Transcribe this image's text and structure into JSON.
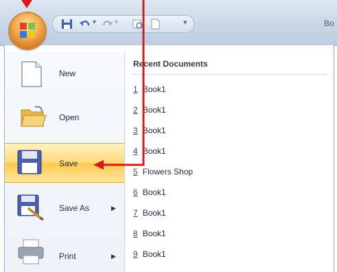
{
  "window": {
    "title_text": "Bo"
  },
  "quick_access": {
    "save_icon": "save-icon",
    "undo_icon": "undo-icon",
    "redo_icon": "redo-icon",
    "print_preview_icon": "print-preview-icon",
    "new_icon": "new-document-icon",
    "customize_icon": "chevron-down-icon"
  },
  "menu": {
    "commands": [
      {
        "label": "New",
        "icon": "blank-document-icon",
        "has_submenu": false
      },
      {
        "label": "Open",
        "icon": "open-folder-icon",
        "has_submenu": false
      },
      {
        "label": "Save",
        "icon": "floppy-disk-icon",
        "has_submenu": false,
        "active": true
      },
      {
        "label": "Save As",
        "icon": "save-as-icon",
        "has_submenu": true
      },
      {
        "label": "Print",
        "icon": "printer-icon",
        "has_submenu": true
      }
    ],
    "recent": {
      "title": "Recent Documents",
      "items": [
        {
          "num": "1",
          "name": "Book1"
        },
        {
          "num": "2",
          "name": "Book1"
        },
        {
          "num": "3",
          "name": "Book1"
        },
        {
          "num": "4",
          "name": "Book1"
        },
        {
          "num": "5",
          "name": "Flowers Shop"
        },
        {
          "num": "6",
          "name": "Book1"
        },
        {
          "num": "7",
          "name": "Book1"
        },
        {
          "num": "8",
          "name": "Book1"
        },
        {
          "num": "9",
          "name": "Book1"
        }
      ]
    }
  },
  "annotations": {
    "arrow_color": "#d61a1a"
  }
}
